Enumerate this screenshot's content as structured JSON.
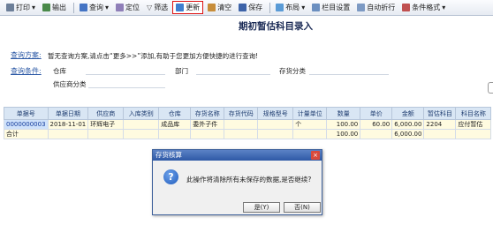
{
  "toolbar": {
    "print": "打印",
    "output": "输出",
    "query": "查询",
    "locate": "定位",
    "filter": "筛选",
    "refresh": "更新",
    "clear": "清空",
    "save": "保存",
    "layout": "布局",
    "column_settings": "栏目设置",
    "auto_wrap": "自动折行",
    "condition_format": "条件格式"
  },
  "title": "期初暂估科目录入",
  "query": {
    "scheme_label": "查询方案:",
    "scheme_hint": "暂无查询方案,请点击“更多>>”添加,有助于您更加方便快捷的进行查询!",
    "condition_label": "查询条件:",
    "warehouse_label": "仓库",
    "department_label": "部门",
    "inventory_class_label": "存货分类",
    "supplier_class_label": "供应商分类"
  },
  "table": {
    "headers": [
      "单据号",
      "单据日期",
      "供应商",
      "入库类别",
      "仓库",
      "存货名称",
      "存货代码",
      "规格型号",
      "计量单位",
      "数量",
      "单价",
      "金额",
      "暂估科目",
      "科目名称"
    ],
    "rows": [
      [
        "0000000003",
        "2018-11-01",
        "环辉电子",
        "",
        "成品库",
        "委外子件",
        "",
        "",
        "个",
        "100.00",
        "60.00",
        "6,000.00",
        "2204",
        "应付暂估"
      ]
    ],
    "total": {
      "label": "合计",
      "quantity": "100.00",
      "amount": "6,000.00"
    }
  },
  "dialog": {
    "title": "存货核算",
    "message": "此操作将清除所有未保存的数据,是否继续?",
    "yes": "是(Y)",
    "no": "否(N)"
  }
}
